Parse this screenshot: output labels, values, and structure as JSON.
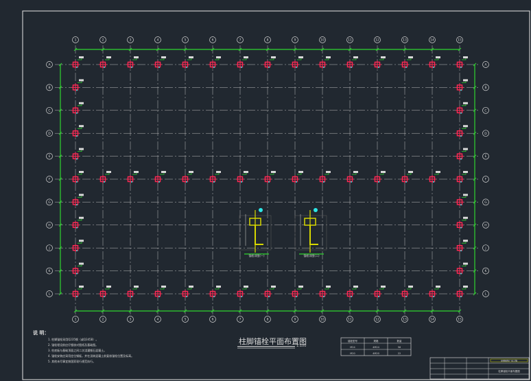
{
  "drawing": {
    "title": "柱脚锚栓平面布置图",
    "scale": "1:100"
  },
  "grid": {
    "columns": [
      "1",
      "2",
      "3",
      "4",
      "5",
      "6",
      "7",
      "8",
      "9",
      "10",
      "11",
      "12",
      "13",
      "14",
      "15"
    ],
    "rows": [
      "A",
      "B",
      "C",
      "D",
      "E",
      "F",
      "G",
      "H",
      "J",
      "K",
      "L"
    ]
  },
  "notes": {
    "heading": "说  明：",
    "items": [
      "1. 柱脚锚栓采用Q235钢（或Q345B）。",
      "2. 锚栓埋设前应仔细核对图纸及基础图。",
      "3. 柱底板与基础顶面之间二次浇灌细石混凝土。",
      "4. 锚栓安装应采用定位钢板，并在浇筑混凝土前复核锚栓位置及标高。",
      "5. 其他未尽事宜按国家现行规范执行。"
    ]
  },
  "details": [
    {
      "label": "锚栓详图(一)"
    },
    {
      "label": "锚栓详图(二)"
    }
  ],
  "legend_table": {
    "header": [
      "锚栓型号",
      "规格",
      "数量"
    ],
    "rows": [
      [
        "M24",
        "4M24",
        "56"
      ],
      [
        "M20",
        "4M20",
        "22"
      ]
    ]
  },
  "title_block": {
    "project": "某钢结构厂房工程",
    "drawing_name": "柱脚锚栓平面布置图"
  }
}
